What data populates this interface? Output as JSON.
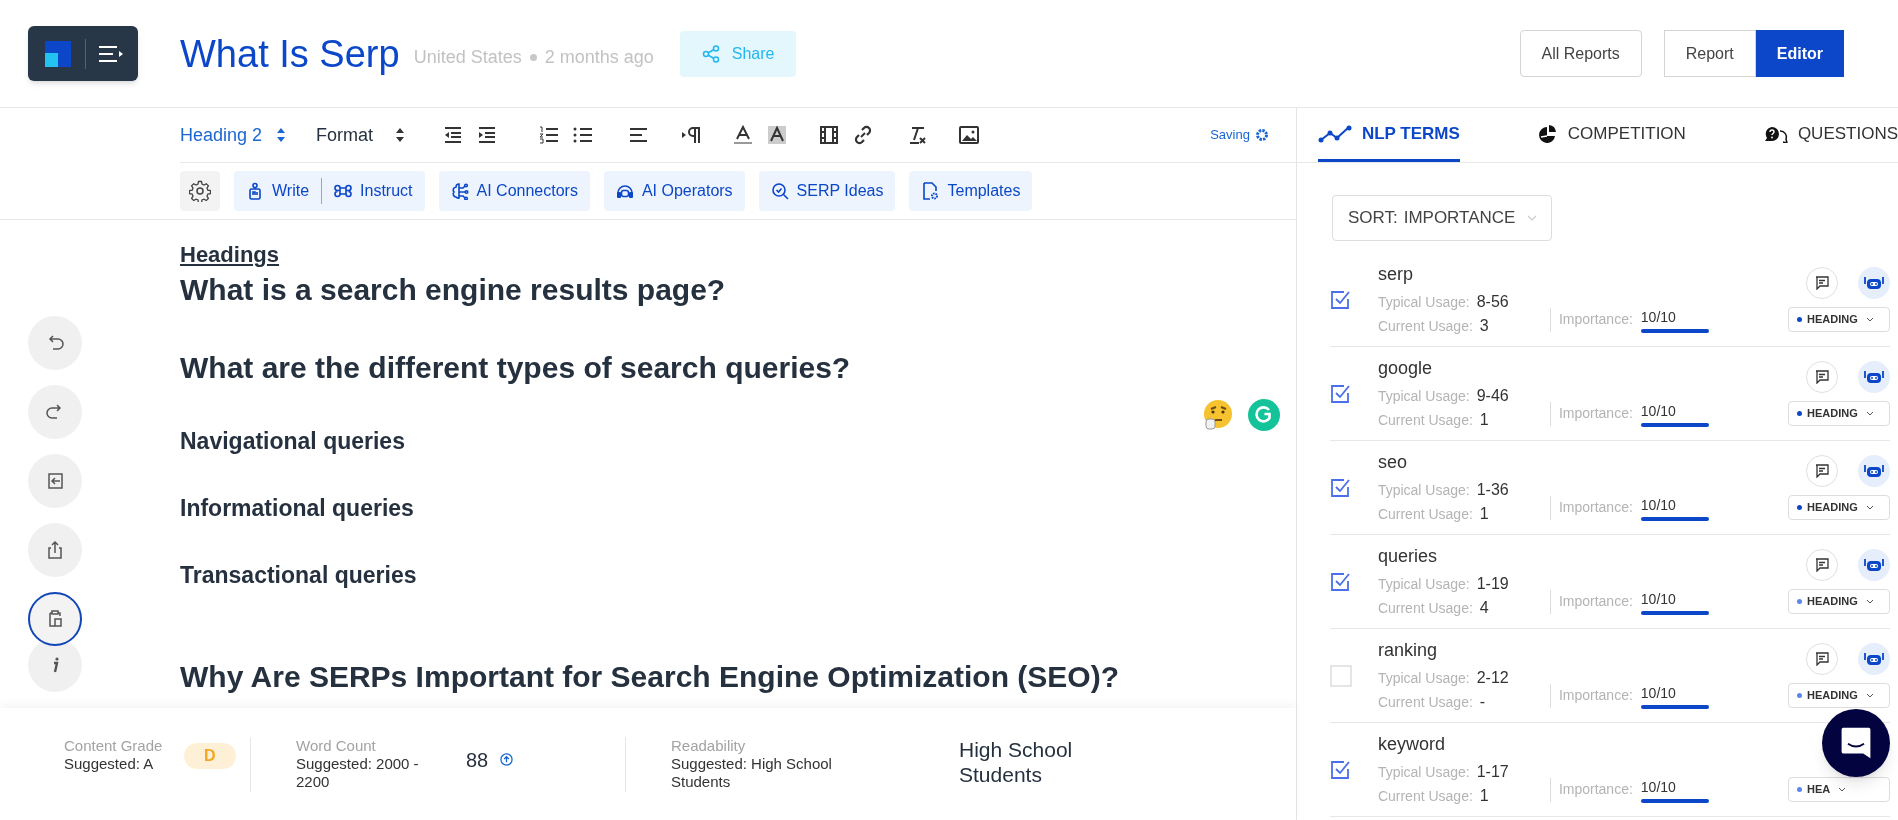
{
  "header": {
    "title": "What Is Serp",
    "location": "United States",
    "time": "2 months ago",
    "share": "Share",
    "all_reports": "All Reports",
    "view_toggle": [
      {
        "label": "Report",
        "selected": false
      },
      {
        "label": "Editor",
        "selected": true
      }
    ]
  },
  "toolbar": {
    "block_format": "Heading 2",
    "format": "Format",
    "status": "Saving"
  },
  "ai_toolbar": [
    {
      "labels": [
        "Write",
        "Instruct"
      ]
    },
    {
      "labels": [
        "AI Connectors"
      ]
    },
    {
      "labels": [
        "AI Operators"
      ]
    },
    {
      "labels": [
        "SERP Ideas"
      ]
    },
    {
      "labels": [
        "Templates"
      ]
    }
  ],
  "side_tools": [
    {
      "kind": "undo",
      "selected": false
    },
    {
      "kind": "redo",
      "selected": false
    },
    {
      "kind": "collapse",
      "selected": false
    },
    {
      "kind": "export",
      "selected": false
    },
    {
      "kind": "clipboard",
      "selected": true
    },
    {
      "kind": "info",
      "selected": false
    }
  ],
  "document": {
    "section_label": "Headings",
    "blocks": [
      {
        "kind": "h2",
        "text": "What is a search engine results page?"
      },
      {
        "kind": "h2",
        "text": "What are the different types of search queries?"
      },
      {
        "kind": "h3",
        "text": "Navigational queries"
      },
      {
        "kind": "h3",
        "text": "Informational queries"
      },
      {
        "kind": "h3",
        "text": "Transactional queries"
      },
      {
        "kind": "h2",
        "text": "Why Are SERPs Important for Search Engine Optimization (SEO)?"
      }
    ]
  },
  "footer": {
    "grade": {
      "label": "Content Grade",
      "suggested": "Suggested: A",
      "value": "D"
    },
    "word_count": {
      "label": "Word Count",
      "suggested": "Suggested: 2000 - 2200",
      "value": "88"
    },
    "readability": {
      "label": "Readability",
      "suggested": "Suggested: High School Students",
      "value": "High School Students"
    }
  },
  "panel": {
    "tabs": [
      {
        "label": "NLP TERMS",
        "selected": true
      },
      {
        "label": "COMPETITION",
        "selected": false
      },
      {
        "label": "QUESTIONS",
        "selected": false
      }
    ],
    "sort": {
      "label": "SORT:",
      "value": "IMPORTANCE"
    },
    "terms": [
      {
        "term": "serp",
        "typical_label": "Typical Usage:",
        "typical": "8-56",
        "current_label": "Current Usage:",
        "current": "3",
        "importance_label": "Importance:",
        "importance": "10/10",
        "level": 1,
        "checked": true,
        "comment": true,
        "assist": true,
        "tag": "HEADING",
        "color": "#0b47c8"
      },
      {
        "term": "google",
        "typical_label": "Typical Usage:",
        "typical": "9-46",
        "current_label": "Current Usage:",
        "current": "1",
        "importance_label": "Importance:",
        "importance": "10/10",
        "level": 1,
        "checked": true,
        "comment": true,
        "assist": true,
        "tag": "HEADING",
        "color": "#0b47c8"
      },
      {
        "term": "seo",
        "typical_label": "Typical Usage:",
        "typical": "1-36",
        "current_label": "Current Usage:",
        "current": "1",
        "importance_label": "Importance:",
        "importance": "10/10",
        "level": 1,
        "checked": true,
        "comment": true,
        "assist": true,
        "tag": "HEADING",
        "color": "#0b47c8"
      },
      {
        "term": "queries",
        "typical_label": "Typical Usage:",
        "typical": "1-19",
        "current_label": "Current Usage:",
        "current": "4",
        "importance_label": "Importance:",
        "importance": "10/10",
        "level": 1,
        "checked": true,
        "comment": true,
        "assist": true,
        "tag": "HEADING",
        "color": "#5b86f0"
      },
      {
        "term": "ranking",
        "typical_label": "Typical Usage:",
        "typical": "2-12",
        "current_label": "Current Usage:",
        "current": "-",
        "importance_label": "Importance:",
        "importance": "10/10",
        "level": 1,
        "checked": false,
        "comment": true,
        "assist": true,
        "tag": "HEADING",
        "color": "#5b86f0"
      },
      {
        "term": "keyword",
        "typical_label": "Typical Usage:",
        "typical": "1-17",
        "current_label": "Current Usage:",
        "current": "1",
        "importance_label": "Importance:",
        "importance": "10/10",
        "level": 1,
        "checked": true,
        "comment": false,
        "assist": false,
        "tag": "HEA",
        "color": "#5b86f0"
      }
    ]
  }
}
